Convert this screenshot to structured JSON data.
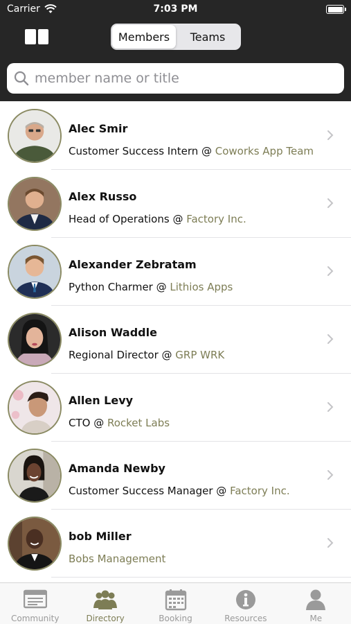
{
  "status_bar": {
    "carrier": "Carrier",
    "time": "7:03 PM"
  },
  "nav": {
    "segments": [
      {
        "label": "Members",
        "active": true
      },
      {
        "label": "Teams",
        "active": false
      }
    ]
  },
  "search": {
    "placeholder": "member name or title",
    "value": ""
  },
  "members": [
    {
      "name": "Alec Smir",
      "title": "Customer Success Intern @ ",
      "company": "Coworks App Team"
    },
    {
      "name": "Alex Russo",
      "title": "Head of Operations @ ",
      "company": "Factory Inc."
    },
    {
      "name": "Alexander Zebratam",
      "title": "Python Charmer @ ",
      "company": "Lithios Apps"
    },
    {
      "name": "Alison Waddle",
      "title": "Regional Director @ ",
      "company": "GRP WRK"
    },
    {
      "name": "Allen Levy",
      "title": "CTO @ ",
      "company": "Rocket Labs"
    },
    {
      "name": "Amanda Newby",
      "title": "Customer Success Manager @ ",
      "company": "Factory Inc."
    },
    {
      "name": "bob Miller",
      "title": " ",
      "company": "Bobs Management"
    }
  ],
  "tabs": [
    {
      "label": "Community",
      "icon": "community-icon",
      "active": false
    },
    {
      "label": "Directory",
      "icon": "directory-icon",
      "active": true
    },
    {
      "label": "Booking",
      "icon": "calendar-icon",
      "active": false
    },
    {
      "label": "Resources",
      "icon": "info-icon",
      "active": false
    },
    {
      "label": "Me",
      "icon": "person-icon",
      "active": false
    }
  ],
  "colors": {
    "accent": "#7d7d55",
    "header": "#262626",
    "inactive_tab": "#9a9a9a"
  }
}
